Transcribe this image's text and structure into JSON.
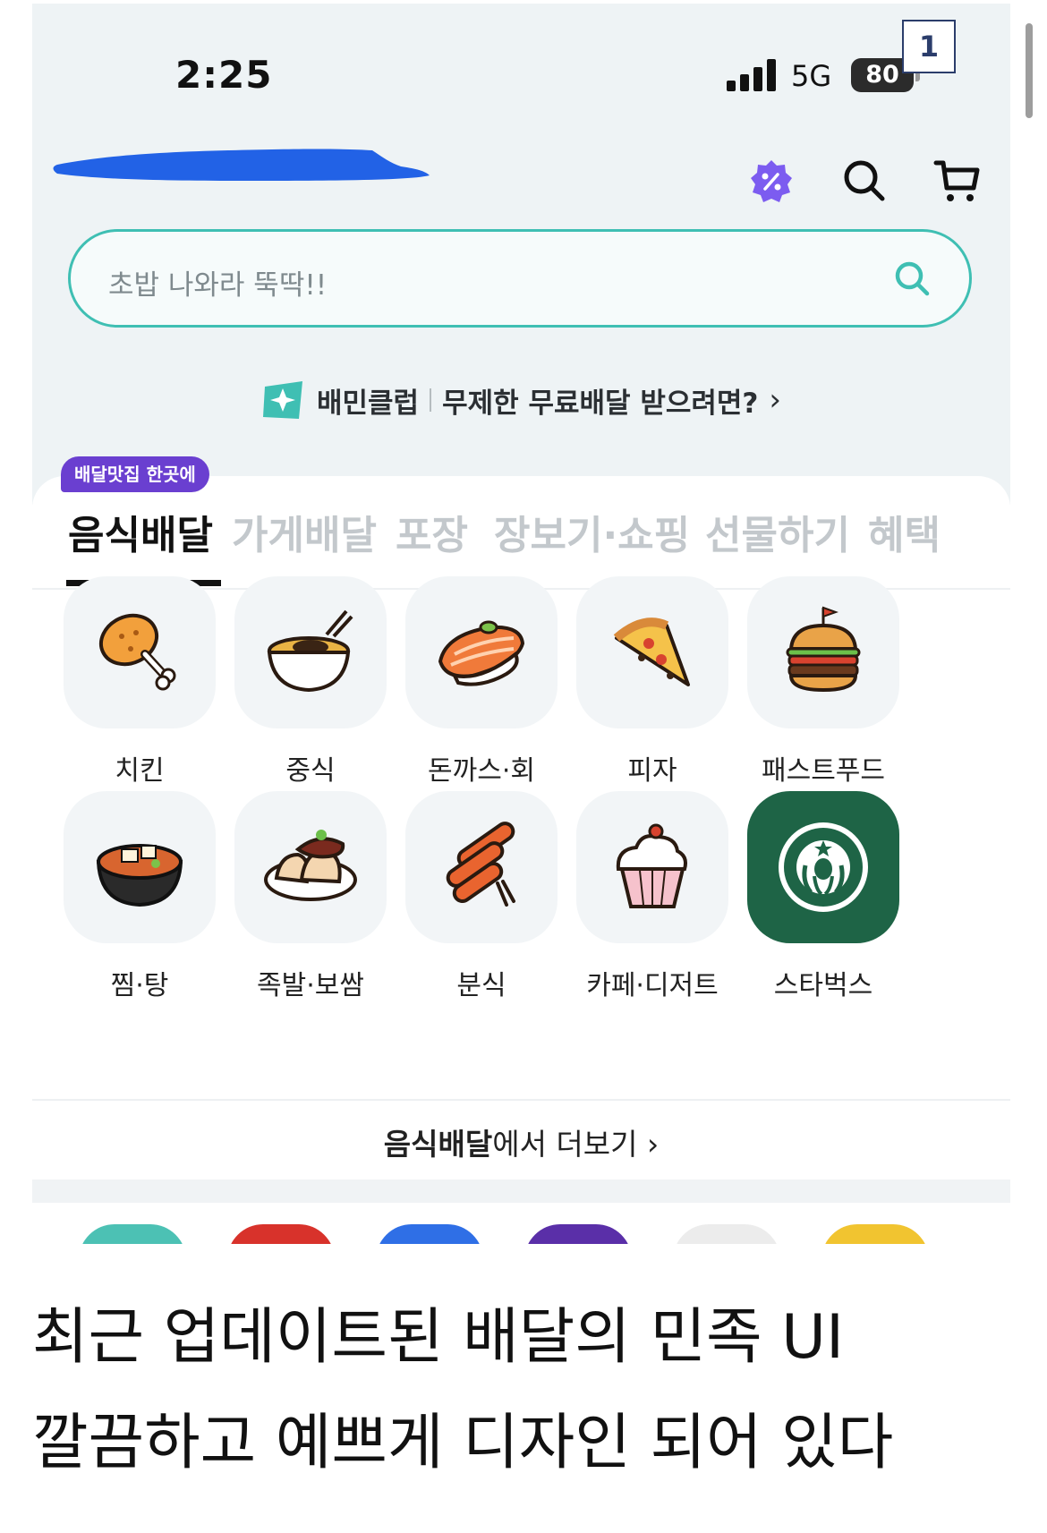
{
  "status_bar": {
    "time": "2:25",
    "network": "5G",
    "battery": "80",
    "page_badge": "1"
  },
  "search": {
    "placeholder": "초밥 나와라 뚝딱!!"
  },
  "club_banner": {
    "name": "배민클럽",
    "text": "무제한 무료배달 받으려면?",
    "chevron": "›"
  },
  "tabs": {
    "badge": "배달맛집 한곳에",
    "items": [
      "음식배달",
      "가게배달",
      "포장",
      "장보기·쇼핑",
      "선물하기",
      "혜택"
    ]
  },
  "categories": [
    {
      "label": "치킨",
      "icon": "chicken-icon"
    },
    {
      "label": "중식",
      "icon": "noodle-bowl-icon"
    },
    {
      "label": "돈까스·회",
      "icon": "sushi-icon"
    },
    {
      "label": "피자",
      "icon": "pizza-icon"
    },
    {
      "label": "패스트푸드",
      "icon": "burger-icon"
    },
    {
      "label": "찜·탕",
      "icon": "stew-pot-icon"
    },
    {
      "label": "족발·보쌈",
      "icon": "jokbal-icon"
    },
    {
      "label": "분식",
      "icon": "tteokbokki-icon"
    },
    {
      "label": "카페·디저트",
      "icon": "cupcake-icon"
    },
    {
      "label": "스타벅스",
      "icon": "starbucks-logo-icon"
    }
  ],
  "more_link": {
    "strong": "음식배달",
    "rest": "에서 더보기",
    "chevron": "›"
  },
  "caption": {
    "line1": "최근 업데이트된 배달의 민족 UI",
    "line2": "깔끔하고 예쁘게 디자인 되어 있다"
  },
  "colors": {
    "accent_teal": "#3fbfb3",
    "badge_purple": "#6a3fd0",
    "starbucks_green": "#1e6446"
  }
}
